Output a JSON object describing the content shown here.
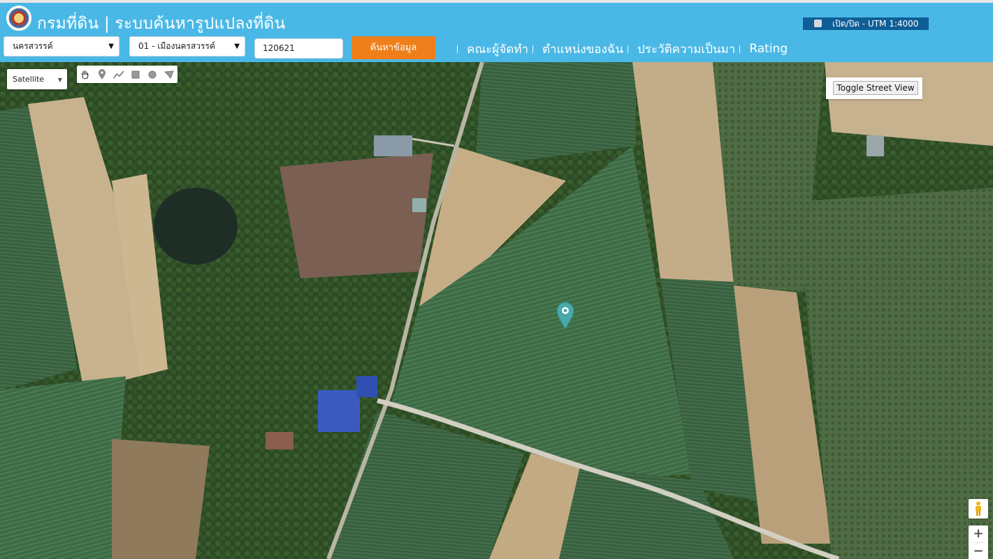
{
  "header": {
    "title": "กรมที่ดิน | ระบบค้นหารูปแปลงที่ดิน",
    "utm_toggle_label": "เปิด/ปิด - UTM 1:4000"
  },
  "search": {
    "province_value": "นครสวรรค์",
    "district_value": "01 - เมืองนครสวรรค์",
    "parcel_value": "120621",
    "search_button": "ค้นหาข้อมูล"
  },
  "nav": {
    "items": [
      {
        "label": "คณะผู้จัดทำ"
      },
      {
        "label": "ตำแหน่งของฉัน"
      },
      {
        "label": "ประวัติความเป็นมา"
      },
      {
        "label": "Rating"
      }
    ]
  },
  "map": {
    "type_selected": "Satellite",
    "street_view_button": "Toggle Street View",
    "zoom_in": "+",
    "zoom_out": "−",
    "tools": [
      "hand-icon",
      "marker-icon",
      "polyline-icon",
      "rectangle-icon",
      "circle-icon",
      "polygon-icon"
    ],
    "marker_color": "#4aa8a8"
  },
  "colors": {
    "header_bg": "#4ab8e6",
    "search_button": "#ef7f1a",
    "utm_toggle_bg": "#0f5e96"
  }
}
